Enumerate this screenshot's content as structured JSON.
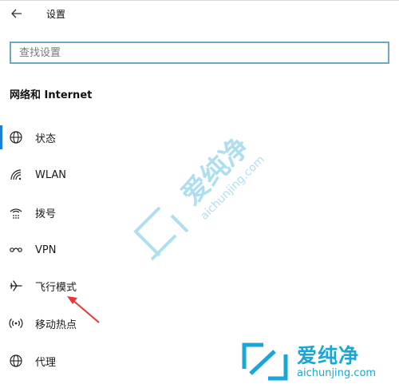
{
  "window": {
    "title": "设置"
  },
  "search": {
    "placeholder": "查找设置",
    "value": ""
  },
  "section": {
    "title": "网络和 Internet"
  },
  "nav": {
    "items": [
      {
        "label": "状态",
        "icon": "globe-icon",
        "selected": true
      },
      {
        "label": "WLAN",
        "icon": "wifi-icon"
      },
      {
        "label": "拨号",
        "icon": "dialup-icon"
      },
      {
        "label": "VPN",
        "icon": "vpn-icon"
      },
      {
        "label": "飞行模式",
        "icon": "airplane-icon"
      },
      {
        "label": "移动热点",
        "icon": "hotspot-icon"
      },
      {
        "label": "代理",
        "icon": "globe-icon"
      }
    ]
  },
  "watermark": {
    "brand": "爱纯净",
    "url": "aichunjing.com",
    "color": "#1aa6d6"
  },
  "colors": {
    "accent": "#1b7fd6",
    "search_border": "#6ea7c8",
    "annotation_arrow": "#e53935"
  }
}
